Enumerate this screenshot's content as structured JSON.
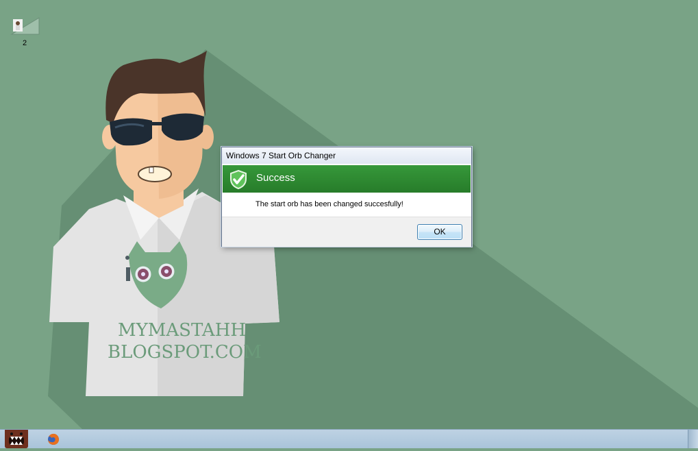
{
  "desktop": {
    "icons": [
      {
        "label": "2",
        "icon": "user-shortcut-icon"
      }
    ],
    "wallpaper": {
      "text_line1": "MYMASTAHH",
      "text_line2": "BLOGSPOT.COM",
      "background_color": "#79a386",
      "shadow_color": "#668f74"
    }
  },
  "dialog": {
    "title": "Windows 7 Start Orb Changer",
    "heading": "Success",
    "message": "The start orb has been changed succesfully!",
    "ok_label": "OK",
    "banner_color": "#2f8c33",
    "icon": "success-shield-icon"
  },
  "taskbar": {
    "start_orb_icon": "domo-start-orb-icon",
    "pinned": [
      {
        "name": "firefox",
        "icon": "firefox-icon"
      }
    ]
  }
}
